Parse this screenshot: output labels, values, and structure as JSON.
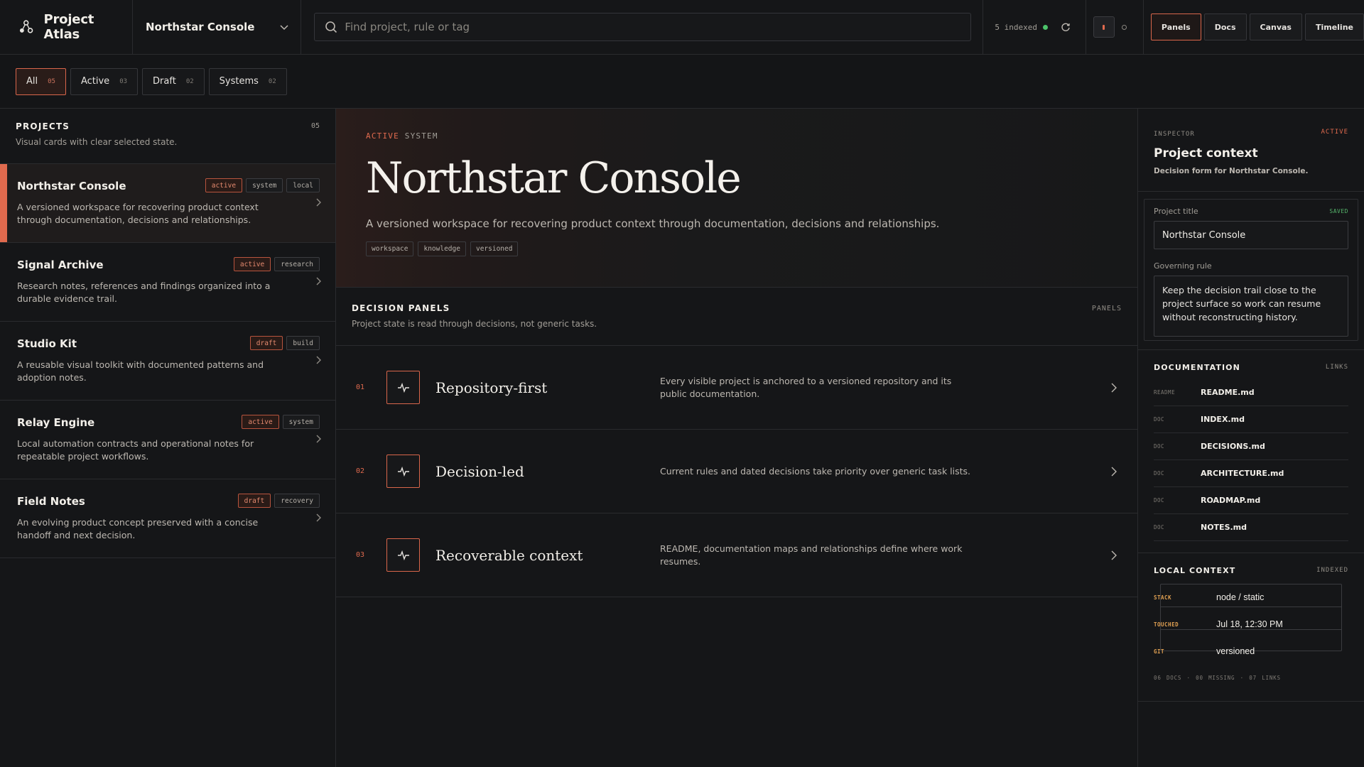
{
  "app": {
    "name": "Project Atlas"
  },
  "project_select": {
    "value": "Northstar Console"
  },
  "search": {
    "placeholder": "Find project, rule or tag"
  },
  "index_status": {
    "text": "5 indexed"
  },
  "view_tabs": [
    "Panels",
    "Docs",
    "Canvas",
    "Timeline"
  ],
  "filters": [
    {
      "name": "All",
      "count": "05"
    },
    {
      "name": "Active",
      "count": "03"
    },
    {
      "name": "Draft",
      "count": "02"
    },
    {
      "name": "Systems",
      "count": "02"
    }
  ],
  "sidebar": {
    "title": "PROJECTS",
    "subtitle": "Visual cards with clear selected state.",
    "count": "05",
    "projects": [
      {
        "name": "Northstar Console",
        "tags": [
          "active",
          "system",
          "local"
        ],
        "desc": "A versioned workspace for recovering product context through documentation, decisions and relationships."
      },
      {
        "name": "Signal Archive",
        "tags": [
          "active",
          "research"
        ],
        "desc": "Research notes, references and findings organized into a durable evidence trail."
      },
      {
        "name": "Studio Kit",
        "tags": [
          "draft",
          "build"
        ],
        "desc": "A reusable visual toolkit with documented patterns and adoption notes."
      },
      {
        "name": "Relay Engine",
        "tags": [
          "active",
          "system"
        ],
        "desc": "Local automation contracts and operational notes for repeatable project workflows."
      },
      {
        "name": "Field Notes",
        "tags": [
          "draft",
          "recovery"
        ],
        "desc": "An evolving product concept preserved with a concise handoff and next decision."
      }
    ]
  },
  "hero": {
    "status": "ACTIVE",
    "kind": "SYSTEM",
    "title": "Northstar Console",
    "lead": "A versioned workspace for recovering product context through documentation, decisions and relationships.",
    "chips": [
      "workspace",
      "knowledge",
      "versioned"
    ]
  },
  "decision_panels": {
    "title": "DECISION PANELS",
    "subtitle": "Project state is read through decisions, not generic tasks.",
    "tag": "PANELS",
    "items": [
      {
        "num": "01",
        "title": "Repository-first",
        "desc": "Every visible project is anchored to a versioned repository and its public documentation."
      },
      {
        "num": "02",
        "title": "Decision-led",
        "desc": "Current rules and dated decisions take priority over generic task lists."
      },
      {
        "num": "03",
        "title": "Recoverable context",
        "desc": "README, documentation maps and relationships define where work resumes."
      }
    ]
  },
  "inspector": {
    "eyebrow": "INSPECTOR",
    "status": "ACTIVE",
    "title": "Project context",
    "subtitle": "Decision form for Northstar Console.",
    "form": {
      "title_label": "Project title",
      "saved": "SAVED",
      "title_value": "Northstar Console",
      "rule_label": "Governing rule",
      "rule_value": "Keep the decision trail close to the project surface so work can resume without reconstructing history."
    },
    "documentation": {
      "title": "DOCUMENTATION",
      "right": "LINKS",
      "items": [
        {
          "kind": "README",
          "file": "README.md"
        },
        {
          "kind": "DOC",
          "file": "INDEX.md"
        },
        {
          "kind": "DOC",
          "file": "DECISIONS.md"
        },
        {
          "kind": "DOC",
          "file": "ARCHITECTURE.md"
        },
        {
          "kind": "DOC",
          "file": "ROADMAP.md"
        },
        {
          "kind": "DOC",
          "file": "NOTES.md"
        }
      ]
    },
    "local_context": {
      "title": "LOCAL CONTEXT",
      "right": "INDEXED",
      "rows": [
        {
          "k": "STACK",
          "v": "node / static"
        },
        {
          "k": "TOUCHED",
          "v": "Jul 18, 12:30 PM"
        },
        {
          "k": "GIT",
          "v": "versioned"
        }
      ],
      "footer": "06 DOCS · 00 MISSING · 07 LINKS"
    }
  },
  "colors": {
    "accent": "#e06a4e",
    "ok": "#4cc36a",
    "bg": "#151618"
  }
}
